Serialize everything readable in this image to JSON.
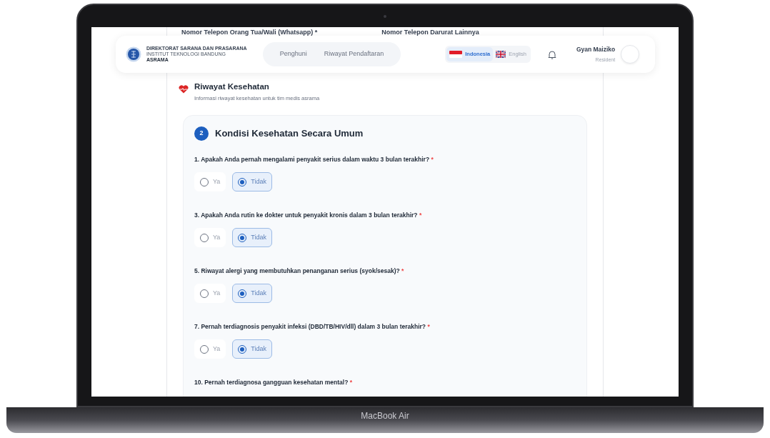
{
  "device": {
    "label": "MacBook Air"
  },
  "top_fields": [
    "Nomor Telepon Orang Tua/Wali (Whatsapp) *",
    "Nomor Telepon Darurat Lainnya"
  ],
  "navbar": {
    "logo_lines": [
      "DIREKTORAT SARANA DAN PRASARANA",
      "INSTITUT TEKNOLOGI BANDUNG",
      "ASRAMA"
    ],
    "links": [
      "Penghuni",
      "Riwayat Pendaftaran"
    ],
    "languages": [
      {
        "label": "Indonesia",
        "kind": "id",
        "selected": true
      },
      {
        "label": "English",
        "kind": "gb",
        "selected": false
      }
    ],
    "user": {
      "name": "Gyan Maiziko",
      "role": "Resident"
    }
  },
  "section": {
    "title": "Riwayat Kesehatan",
    "subtitle": "Informasi riwayat kesehatan untuk tim medis asrama"
  },
  "card": {
    "step": "2",
    "title": "Kondisi Kesehatan Secara Umum",
    "questions": [
      {
        "label": "1. Apakah Anda pernah mengalami penyakit serius dalam waktu 3 bulan terakhir?",
        "required_mark": "*",
        "options": [
          {
            "label": "Ya",
            "selected": false
          },
          {
            "label": "Tidak",
            "selected": true
          }
        ]
      },
      {
        "label": "3. Apakah Anda rutin ke dokter untuk penyakit kronis dalam 3 bulan terakhir?",
        "required_mark": "*",
        "options": [
          {
            "label": "Ya",
            "selected": false
          },
          {
            "label": "Tidak",
            "selected": true
          }
        ]
      },
      {
        "label": "5. Riwayat alergi yang membutuhkan penanganan serius (syok/sesak)?",
        "required_mark": "*",
        "options": [
          {
            "label": "Ya",
            "selected": false
          },
          {
            "label": "Tidak",
            "selected": true
          }
        ]
      },
      {
        "label": "7. Pernah terdiagnosis penyakit infeksi (DBD/TB/HIV/dll) dalam 3 bulan terakhir?",
        "required_mark": "*",
        "options": [
          {
            "label": "Ya",
            "selected": false
          },
          {
            "label": "Tidak",
            "selected": true
          }
        ]
      },
      {
        "label": "10. Pernah terdiagnosa gangguan kesehatan mental?",
        "required_mark": "*"
      }
    ]
  }
}
